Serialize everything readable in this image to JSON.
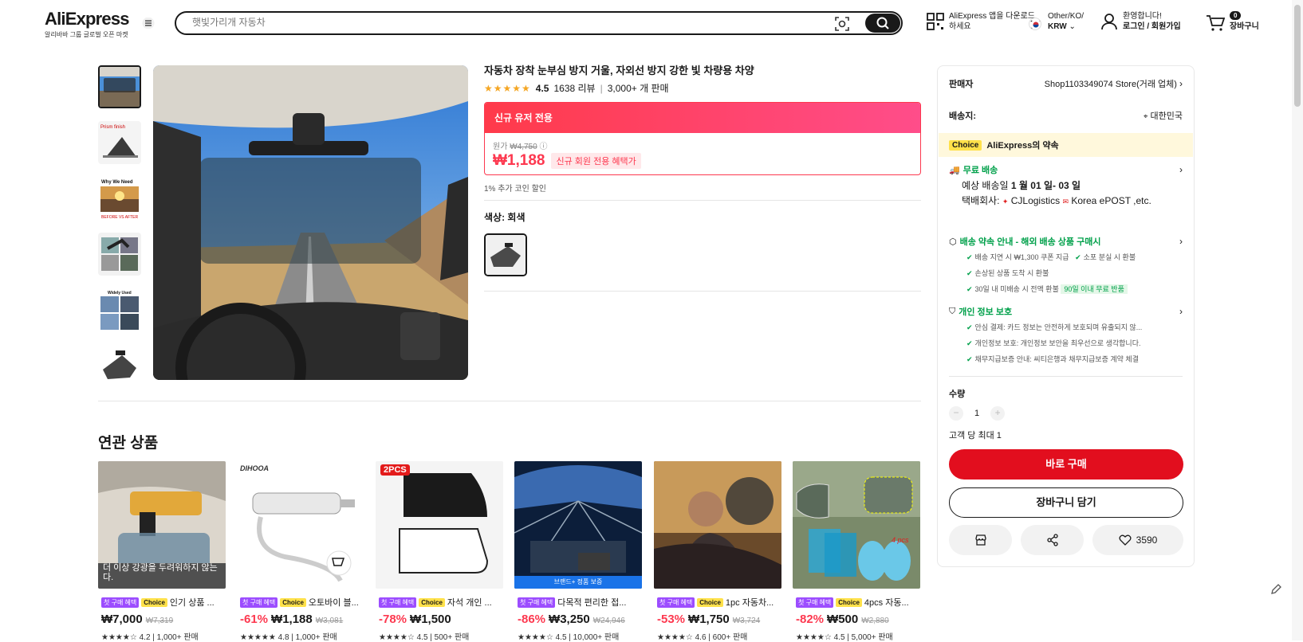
{
  "header": {
    "logo": "AliExpress",
    "logo_sub": "알리바바 그룹 글로벌 오픈 마켓",
    "search_placeholder": "햇빛가리개 자동차",
    "app_download": "AliExpress 앱을 다운로드하세요",
    "region_line1": "Other/KO/",
    "region_currency": "KRW",
    "welcome": "환영합니다!",
    "login": "로그인 / 회원가입",
    "cart_count": "0",
    "cart_label": "장바구니"
  },
  "product": {
    "title": "자동차 장착 눈부심 방지 거울, 자외선 방지 강한 빛 차량용 차양",
    "rating": "4.5",
    "reviews": "1638 리뷰",
    "sold": "3,000+ 개 판매",
    "new_user_banner": "신규 유저 전용",
    "orig_label": "원가",
    "orig_price": "₩4,750",
    "price": "₩1,188",
    "price_badge": "신규 회원 전용 혜택가",
    "coin": "1% 추가 코인 할인",
    "color_label": "색상: 회색"
  },
  "related": {
    "title": "연관 상품",
    "first_tag": "첫 구매 혜택",
    "choice_tag": "Choice",
    "items": [
      {
        "name": "인기 상품 ...",
        "discount": "",
        "price": "₩7,000",
        "old": "₩7,319",
        "rating": "4.2",
        "sold": "1,000+ 판매",
        "overlay": "더 이상 강광을 두려워하지 않는다."
      },
      {
        "name": "오토바이 블...",
        "discount": "-61%",
        "price": "₩1,188",
        "old": "₩3,081",
        "rating": "4.8",
        "sold": "1,000+ 판매",
        "overlay": "DIHOOA"
      },
      {
        "name": "자석 개인 ...",
        "discount": "-78%",
        "price": "₩1,500",
        "old": "",
        "rating": "4.5",
        "sold": "500+ 판매",
        "overlay": "2PCS"
      },
      {
        "name": "다목적 편리한 접...",
        "discount": "-86%",
        "price": "₩3,250",
        "old": "₩24,946",
        "rating": "4.5",
        "sold": "10,000+ 판매",
        "overlay": "브랜드+ 정품 보증"
      },
      {
        "name": "1pc 자동차...",
        "discount": "-53%",
        "price": "₩1,750",
        "old": "₩3,724",
        "rating": "4.6",
        "sold": "600+ 판매",
        "overlay": ""
      },
      {
        "name": "4pcs 자동...",
        "discount": "-82%",
        "price": "₩500",
        "old": "₩2,880",
        "rating": "4.5",
        "sold": "5,000+ 판매",
        "overlay": "4 pcs"
      }
    ]
  },
  "sidebar": {
    "seller_label": "판매자",
    "seller_value": "Shop1103349074 Store(거래 업체)",
    "ship_to_label": "배송지:",
    "ship_to_value": "대한민국",
    "promise_badge": "Choice",
    "promise_text": "AliExpress의 약속",
    "free_ship": "무료 배송",
    "eta_prefix": "예상 배송일",
    "eta": "1 월 01 일- 03 일",
    "carrier_prefix": "택배회사:",
    "carrier1": "CJLogistics",
    "carrier2": "Korea ePOST ,etc.",
    "delivery_guide": "배송 약속 안내 - 해외 배송 상품 구매시",
    "check1": "배송 지연 시 ₩1,300 쿠폰 지급",
    "check1b": "소포 분실 시 환불",
    "check2": "손상된 상품 도착 시 환불",
    "check3": "30일 내 미배송 시 전액 환불",
    "check3_badge": "90일 이내 무료 반품",
    "privacy": "개인 정보 보호",
    "priv1": "안심 결제: 카드 정보는 안전하게 보호되며 유출되지 않...",
    "priv2": "개인정보 보호: 개인정보 보안을 최우선으로 생각합니다.",
    "priv3": "채무지급보증 안내: 씨티은행과 채무지급보증 계약 체결",
    "qty_label": "수량",
    "qty_value": "1",
    "qty_minus": "−",
    "qty_plus": "+",
    "limit": "고객 당 최대 1",
    "buy_now": "바로 구매",
    "add_cart": "장바구니 담기",
    "wish_count": "3590"
  },
  "colors": {
    "accent_red": "#fd384f",
    "buy_red": "#e20e1e",
    "choice_yellow": "#ffe14a",
    "green": "#00a04a"
  }
}
